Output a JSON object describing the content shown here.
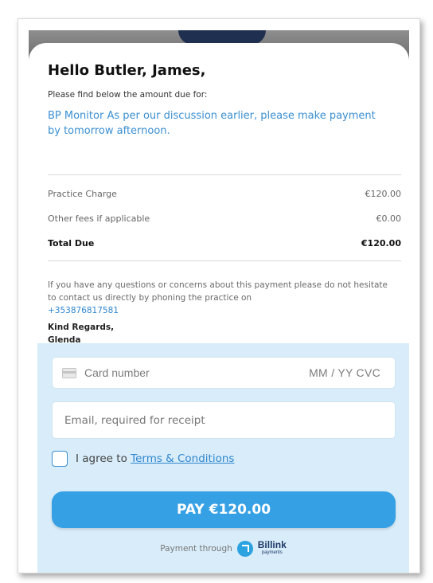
{
  "header": {
    "greeting": "Hello Butler, James,",
    "subtitle": "Please find below the amount due for:",
    "description": "BP Monitor As per our discussion earlier, please make payment by tomorrow afternoon."
  },
  "charges": [
    {
      "label": "Practice Charge",
      "amount": "€120.00"
    },
    {
      "label": "Other fees if applicable",
      "amount": "€0.00"
    }
  ],
  "total": {
    "label": "Total Due",
    "amount": "€120.00"
  },
  "contact": {
    "note": "If you have any questions or concerns about this payment please do not hesitate to contact us directly by phoning the practice on",
    "phone": "+353876817581",
    "regards": "Kind Regards,",
    "signature": "Glenda"
  },
  "payment_form": {
    "card_placeholder": "Card number",
    "card_extra_placeholder": "MM / YY  CVC",
    "email_placeholder": "Email, required for receipt",
    "agree_prefix": "I agree to",
    "terms_link": "Terms & Conditions",
    "pay_button": "PAY €120.00",
    "payment_through": "Payment through",
    "brand_name": "Billink",
    "brand_sub": "payments"
  },
  "icons": {
    "card": "credit-card-icon",
    "brand": "billink-logo-icon"
  },
  "colors": {
    "accent": "#36a0e4",
    "link": "#2f86cf",
    "panel": "#d8ecf9",
    "brand_dark": "#1f3a68"
  }
}
